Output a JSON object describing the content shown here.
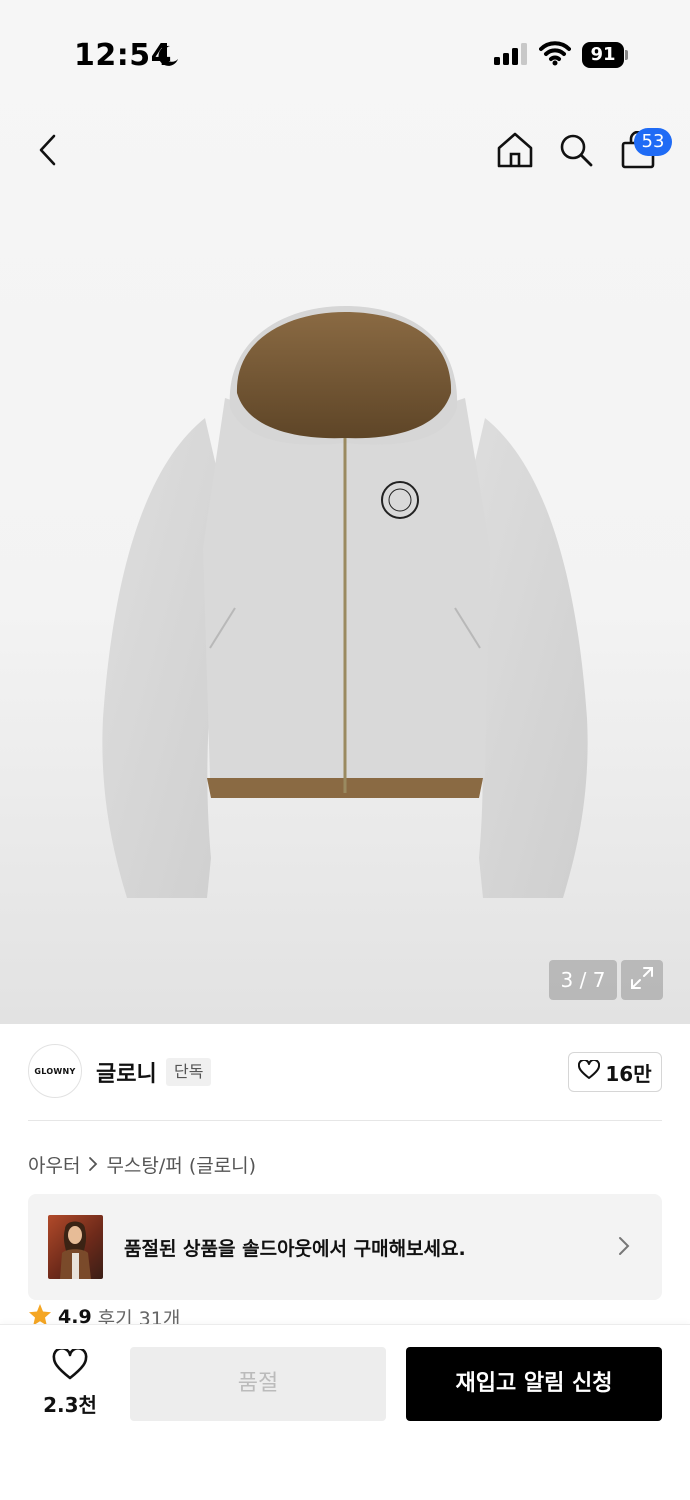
{
  "status_bar": {
    "time": "12:54",
    "battery": "91"
  },
  "top_nav": {
    "cart_badge": "53",
    "icons": [
      "back-icon",
      "home-icon",
      "search-icon",
      "shopping-bag-icon"
    ]
  },
  "gallery": {
    "counter": "3 / 7",
    "current": 3,
    "total": 7
  },
  "brand": {
    "logo_text": "GLOWNY",
    "name": "글로니",
    "badge": "단독",
    "likes": "16만"
  },
  "breadcrumb": {
    "items": [
      "아우터",
      "무스탕/퍼 (글로니)"
    ]
  },
  "soldout_banner": {
    "text": "품절된 상품을 솔드아웃에서 구매해보세요."
  },
  "rating": {
    "score": "4.9",
    "reviews": "후기 31개"
  },
  "bottom_bar": {
    "wish_count": "2.3천",
    "soldout_label": "품절",
    "restock_label": "재입고 알림 신청"
  },
  "colors": {
    "badge_blue": "#1f6bf5",
    "primary_button": "#000000",
    "star": "#f5a623"
  }
}
